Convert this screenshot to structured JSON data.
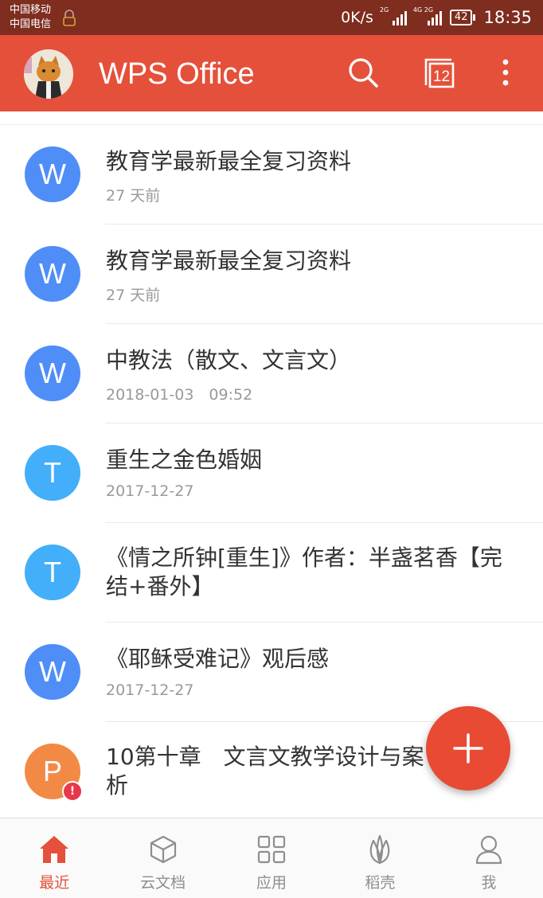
{
  "status_bar": {
    "carrier_1": "中国移动",
    "carrier_2": "中国电信",
    "net_speed": "0K/s",
    "signal_1_tag": "2G",
    "signal_2_tag": "4G 2G",
    "battery": "42",
    "time": "18:35"
  },
  "app_bar": {
    "title": "WPS Office",
    "tab_count": "12",
    "icons": [
      "avatar",
      "search-icon",
      "tabs-icon",
      "more-vert-icon"
    ]
  },
  "files": [
    {
      "icon": "W",
      "title": "教育学最新最全复习资料",
      "meta": "27 天前",
      "icon_color": "#4f8ef7"
    },
    {
      "icon": "W",
      "title": "教育学最新最全复习资料",
      "meta": "27 天前",
      "icon_color": "#4f8ef7"
    },
    {
      "icon": "W",
      "title": "中教法（散文、文言文）",
      "meta": "2018-01-03　09:52",
      "icon_color": "#4f8ef7"
    },
    {
      "icon": "T",
      "title": "重生之金色婚姻",
      "meta": "2017-12-27",
      "icon_color": "#43aef9"
    },
    {
      "icon": "T",
      "title": "《情之所钟[重生]》作者：半盏茗香【完结+番外】",
      "meta": "",
      "icon_color": "#43aef9"
    },
    {
      "icon": "W",
      "title": "《耶稣受难记》观后感",
      "meta": "2017-12-27",
      "icon_color": "#4f8ef7"
    },
    {
      "icon": "P",
      "title": "10第十章　文言文教学设计与案析",
      "meta": "",
      "icon_color": "#f28a46",
      "badge": "!"
    }
  ],
  "fab": {
    "icon": "plus-icon"
  },
  "bottom_nav": [
    {
      "label": "最近",
      "icon": "home-icon",
      "active": true
    },
    {
      "label": "云文档",
      "icon": "cube-icon",
      "active": false
    },
    {
      "label": "应用",
      "icon": "grid-icon",
      "active": false
    },
    {
      "label": "稻壳",
      "icon": "leaf-icon",
      "active": false
    },
    {
      "label": "我",
      "icon": "person-icon",
      "active": false
    }
  ],
  "colors": {
    "primary": "#e5503a",
    "status_bar": "#7e2d1e",
    "word_blue": "#4f8ef7",
    "text_blue": "#43aef9",
    "ppt_orange": "#f28a46"
  }
}
